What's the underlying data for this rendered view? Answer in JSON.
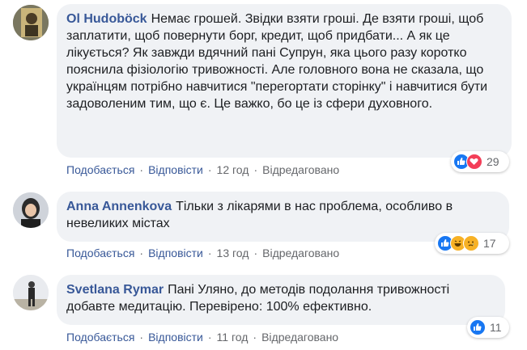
{
  "comments": [
    {
      "author": "Ol Hudoböck",
      "text": "Немає грошей. Звідки взяти гроші. Де взяти гроші, щоб заплатити, щоб повернути борг, кредит, щоб придбати... А як це лікується? Як завжди вдячний пані Супрун, яка цього разу коротко пояснила фізіологію тривожності. Але головного вона не сказала, що українцям потрібно навчитися \"перегортати сторінку\" і навчитися бути задоволеним тим, що є. Це важко, бо це із сфери духовного.",
      "like_label": "Подобається",
      "reply_label": "Відповісти",
      "time": "12 год",
      "edited": "Відредаговано",
      "reaction_count": "29",
      "reactions": [
        "like-icon",
        "love-icon"
      ]
    },
    {
      "author": "Anna Annenkova",
      "text": "Тільки з лікарями в нас проблема, особливо в невеликих містах",
      "like_label": "Подобається",
      "reply_label": "Відповісти",
      "time": "13 год",
      "edited": "Відредаговано",
      "reaction_count": "17",
      "reactions": [
        "like-icon",
        "haha-icon",
        "sad-icon"
      ]
    },
    {
      "author": "Svetlana Rymar",
      "text": "Пані Уляно, до методів подолання тривожності добавте медитацію. Перевірено: 100% ефективно.",
      "like_label": "Подобається",
      "reply_label": "Відповісти",
      "time": "11 год",
      "edited": "Відредаговано",
      "reaction_count": "11",
      "reactions": [
        "like-icon"
      ]
    }
  ],
  "colors": {
    "author": "#385898",
    "bubble": "#f0f2f5",
    "meta": "#65676b",
    "like": "#1877f2",
    "love": "#f33e58",
    "haha": "#f7b125"
  }
}
